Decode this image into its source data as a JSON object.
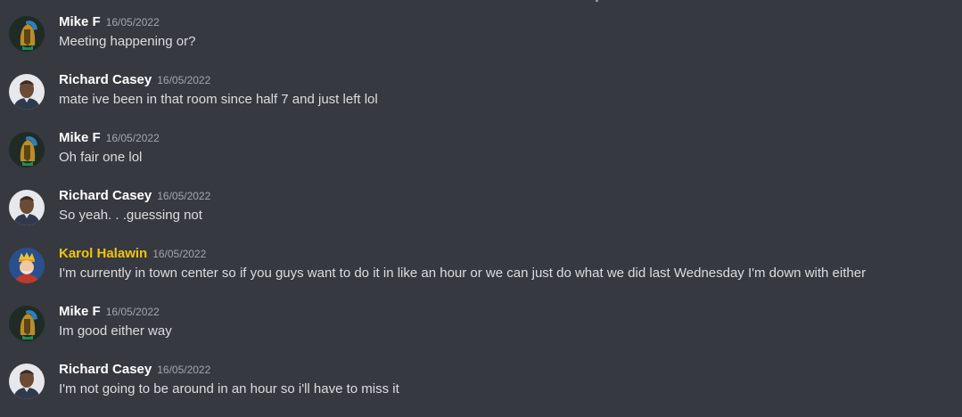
{
  "messages": [
    {
      "author": "Mike F",
      "timestamp": "16/05/2022",
      "text": "Meeting happening or?",
      "avatar": "spartan-helmet-icon",
      "name_color": "#ffffff"
    },
    {
      "author": "Richard Casey",
      "timestamp": "16/05/2022",
      "text": "mate ive been in that room since half 7 and just left lol",
      "avatar": "profile-photo",
      "name_color": "#ffffff"
    },
    {
      "author": "Mike F",
      "timestamp": "16/05/2022",
      "text": "Oh fair one lol",
      "avatar": "spartan-helmet-icon",
      "name_color": "#ffffff"
    },
    {
      "author": "Richard Casey",
      "timestamp": "16/05/2022",
      "text": "So yeah. . .guessing not",
      "avatar": "profile-photo",
      "name_color": "#ffffff"
    },
    {
      "author": "Karol Halawin",
      "timestamp": "16/05/2022",
      "text": "I'm currently in town center so if you guys want to do it in like an hour or we can just do what we did last Wednesday I'm down with either",
      "avatar": "king-character-icon",
      "name_color": "#f1c40f"
    },
    {
      "author": "Mike F",
      "timestamp": "16/05/2022",
      "text": "Im good either way",
      "avatar": "spartan-helmet-icon",
      "name_color": "#ffffff"
    },
    {
      "author": "Richard Casey",
      "timestamp": "16/05/2022",
      "text": "I'm not going to be around in an hour so i'll have to miss it",
      "avatar": "profile-photo",
      "name_color": "#ffffff"
    }
  ],
  "colors": {
    "background": "#36393f",
    "text": "#dcddde",
    "timestamp": "#a3a6aa",
    "highlight_name": "#f1c40f"
  }
}
